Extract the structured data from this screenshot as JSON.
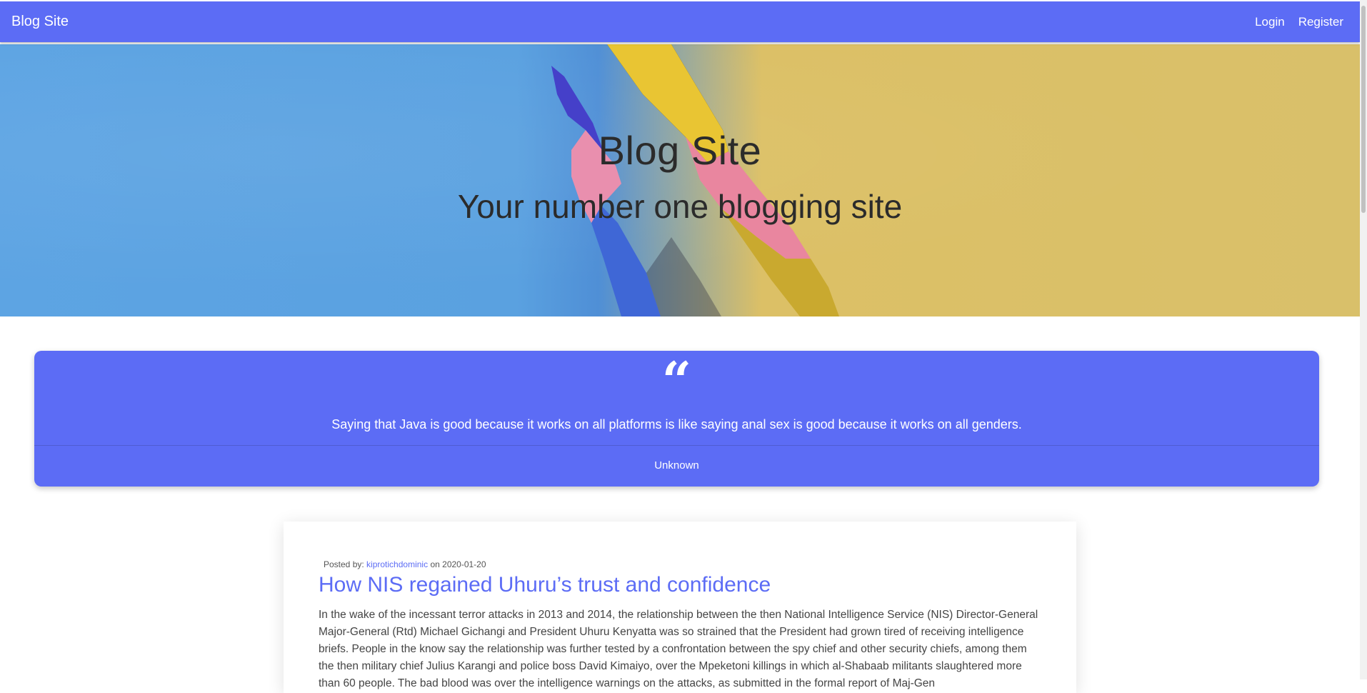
{
  "navbar": {
    "brand": "Blog Site",
    "links": [
      "Login",
      "Register"
    ],
    "background_color": "#5c6cf5"
  },
  "hero": {
    "title": "Blog Site",
    "subtitle": "Your number one blogging site"
  },
  "quote": {
    "icon": "quote-open-icon",
    "text": "Saying that Java is good because it works on all platforms is like saying anal sex is good because it works on all genders.",
    "author": "Unknown",
    "background_color": "#5c6cf5"
  },
  "post": {
    "posted_by_label": "Posted by:",
    "author": "kiprotichdominic",
    "on_label": "on",
    "date": "2020-01-20",
    "title": "How NIS regained Uhuru’s trust and confidence",
    "excerpt": "In the wake of the incessant terror attacks in 2013 and 2014, the relationship between the then National Intelligence Service (NIS) Director-General Major-General (Rtd) Michael Gichangi and President Uhuru Kenyatta was so strained that the President had grown tired of receiving intelligence briefs. People in the know say the relationship was further tested by a confrontation between the spy chief and other security chiefs, among them the then military chief Julius Karangi and police boss David Kimaiyo, over the Mpeketoni killings in which al-Shabaab militants slaughtered more than 60 people. The bad blood was over the intelligence warnings on the attacks, as submitted in the formal report of Maj-Gen"
  }
}
